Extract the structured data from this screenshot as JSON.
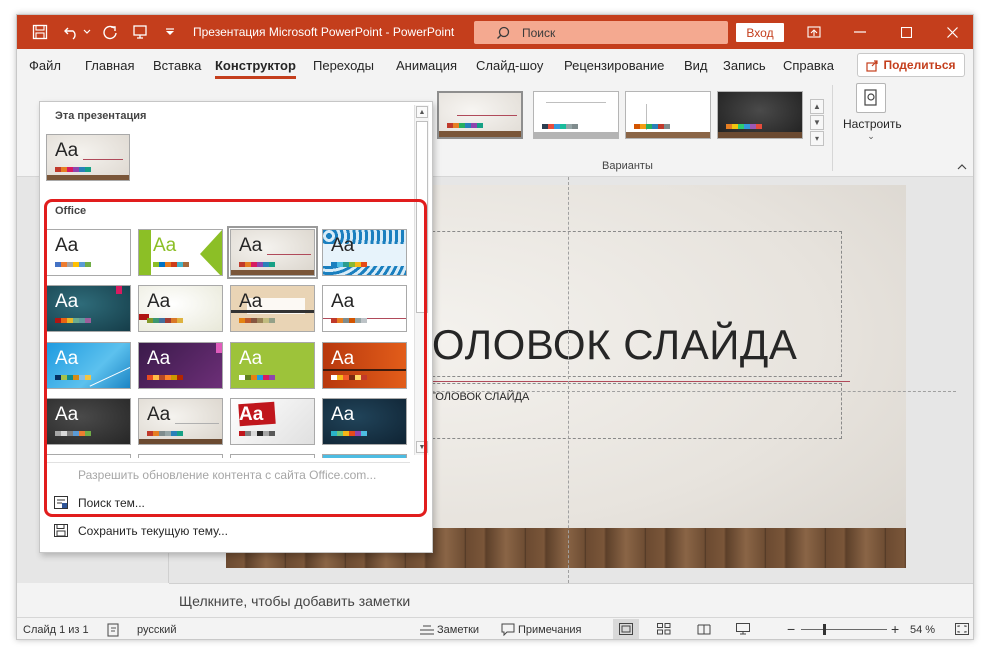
{
  "titlebar": {
    "title": "Презентация Microsoft PowerPoint  -  PowerPoint",
    "search_label": "Поиск",
    "signin_label": "Вход",
    "accent": "#c43e1c"
  },
  "menu": {
    "items": [
      "Файл",
      "Главная",
      "Вставка",
      "Конструктор",
      "Переходы",
      "Анимация",
      "Слайд-шоу",
      "Рецензирование",
      "Вид",
      "Запись",
      "Справка"
    ],
    "active": "Конструктор",
    "share_label": "Поделиться"
  },
  "ribbon": {
    "variants_label": "Варианты",
    "customize_label": "Настроить"
  },
  "theme_panel": {
    "this_presentation_heading": "Эта презентация",
    "office_heading": "Office",
    "aa_label": "Aa",
    "allow_updates_label": "Разрешить обновление контента с сайта Office.com...",
    "search_themes_label": "Поиск тем...",
    "save_theme_label": "Сохранить текущую тему...",
    "highlight_color": "#e11d1d"
  },
  "slide": {
    "title_text": "ГОЛОВОК СЛАЙДА",
    "subtitle_text": "ЗАГОЛОВОК СЛАЙДА"
  },
  "notes": {
    "placeholder": "Щелкните, чтобы добавить заметки"
  },
  "statusbar": {
    "slide_counter": "Слайд 1 из 1",
    "language": "русский",
    "notes_label": "Заметки",
    "comments_label": "Примечания",
    "zoom_minus": "−",
    "zoom_plus": "+",
    "zoom_percent": "54 %"
  }
}
